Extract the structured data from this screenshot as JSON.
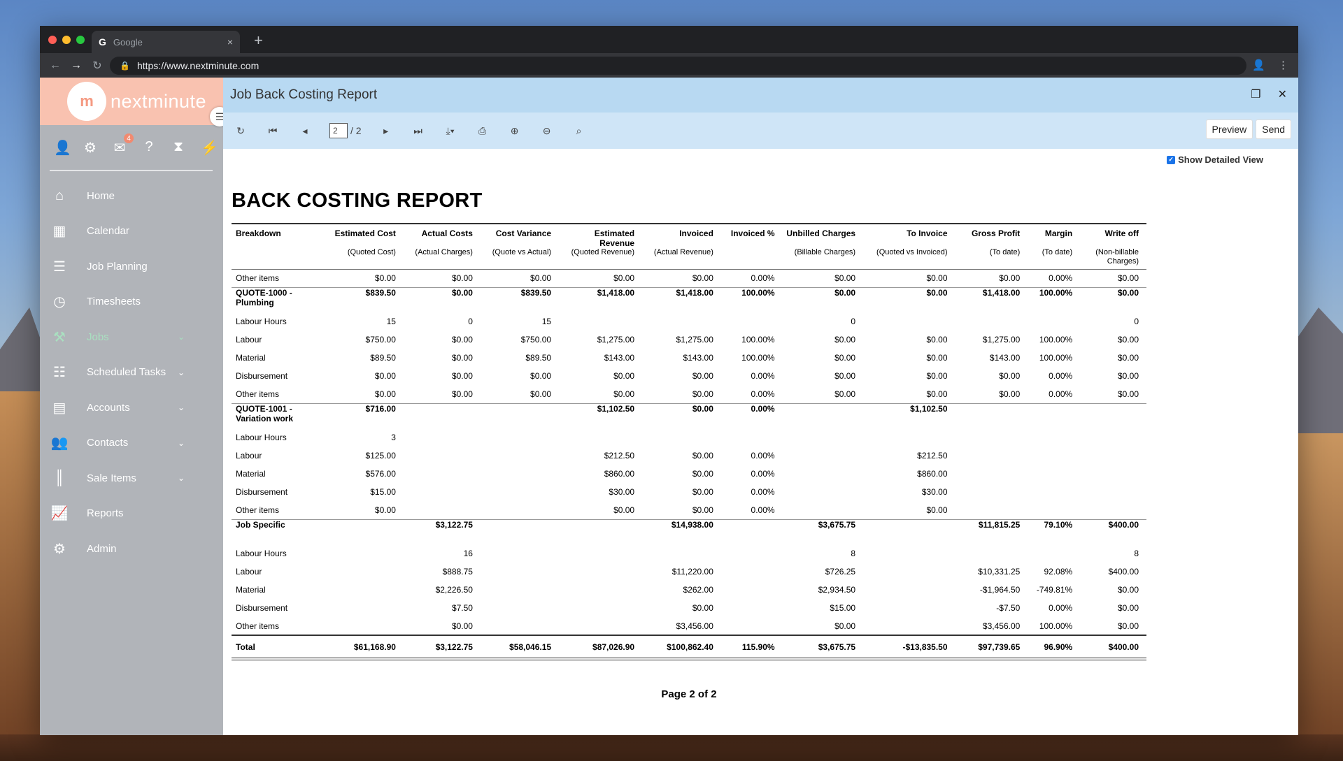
{
  "browser": {
    "tab_title": "Google",
    "tab_favicon": "G",
    "url": "https://www.nextminute.com"
  },
  "brand": {
    "logo_mark": "m",
    "logo_text": "nextminute",
    "color": "#f9c2b0"
  },
  "quick_icons": [
    {
      "name": "user-icon",
      "glyph": "👤"
    },
    {
      "name": "gear-icon",
      "glyph": "⚙"
    },
    {
      "name": "mail-icon",
      "glyph": "✉",
      "badge": "4"
    },
    {
      "name": "help-icon",
      "glyph": "?"
    },
    {
      "name": "hourglass-icon",
      "glyph": "⧗"
    },
    {
      "name": "bolt-icon",
      "glyph": "⚡"
    }
  ],
  "sidebar": {
    "items": [
      {
        "label": "Home",
        "icon": "home-icon",
        "glyph": "⌂"
      },
      {
        "label": "Calendar",
        "icon": "calendar-icon",
        "glyph": "▦"
      },
      {
        "label": "Job Planning",
        "icon": "list-icon",
        "glyph": "☰"
      },
      {
        "label": "Timesheets",
        "icon": "clock-icon",
        "glyph": "◷"
      },
      {
        "label": "Jobs",
        "icon": "hammer-icon",
        "glyph": "⚒",
        "chevron": true,
        "active": true
      },
      {
        "label": "Scheduled Tasks",
        "icon": "tasks-icon",
        "glyph": "☷",
        "chevron": true
      },
      {
        "label": "Accounts",
        "icon": "document-icon",
        "glyph": "▤",
        "chevron": true
      },
      {
        "label": "Contacts",
        "icon": "people-icon",
        "glyph": "👥",
        "chevron": true
      },
      {
        "label": "Sale Items",
        "icon": "barcode-icon",
        "glyph": "║",
        "chevron": true
      },
      {
        "label": "Reports",
        "icon": "chart-icon",
        "glyph": "📈"
      },
      {
        "label": "Admin",
        "icon": "admin-gear-icon",
        "glyph": "⚙"
      }
    ]
  },
  "report_window": {
    "title": "Job Back Costing Report",
    "page_current": "2",
    "page_total": "/ 2",
    "preview_label": "Preview",
    "send_label": "Send",
    "show_detailed_label": "Show Detailed View"
  },
  "report": {
    "title": "BACK COSTING REPORT",
    "columns": [
      {
        "head": "Breakdown",
        "sub": ""
      },
      {
        "head": "Estimated Cost",
        "sub": "(Quoted Cost)"
      },
      {
        "head": "Actual Costs",
        "sub": "(Actual Charges)"
      },
      {
        "head": "Cost Variance",
        "sub": "(Quote vs Actual)"
      },
      {
        "head": "Estimated Revenue",
        "sub": "(Quoted Revenue)"
      },
      {
        "head": "Invoiced",
        "sub": "(Actual Revenue)"
      },
      {
        "head": "Invoiced %",
        "sub": ""
      },
      {
        "head": "Unbilled Charges",
        "sub": "(Billable Charges)"
      },
      {
        "head": "To Invoice",
        "sub": "(Quoted vs Invoiced)"
      },
      {
        "head": "Gross Profit",
        "sub": "(To date)"
      },
      {
        "head": "Margin",
        "sub": "(To date)"
      },
      {
        "head": "Write off",
        "sub": "(Non-billable Charges)"
      }
    ],
    "rows": [
      {
        "type": "row",
        "cells": [
          "Other items",
          "$0.00",
          "$0.00",
          "$0.00",
          "$0.00",
          "$0.00",
          "0.00%",
          "$0.00",
          "$0.00",
          "$0.00",
          "0.00%",
          "$0.00"
        ]
      },
      {
        "type": "group",
        "cells": [
          "QUOTE-1000 - Plumbing",
          "$839.50",
          "$0.00",
          "$839.50",
          "$1,418.00",
          "$1,418.00",
          "100.00%",
          "$0.00",
          "$0.00",
          "$1,418.00",
          "100.00%",
          "$0.00"
        ]
      },
      {
        "type": "row",
        "cells": [
          "Labour Hours",
          "15",
          "0",
          "15",
          "",
          "",
          "",
          "0",
          "",
          "",
          "",
          "0"
        ]
      },
      {
        "type": "row",
        "cells": [
          "Labour",
          "$750.00",
          "$0.00",
          "$750.00",
          "$1,275.00",
          "$1,275.00",
          "100.00%",
          "$0.00",
          "$0.00",
          "$1,275.00",
          "100.00%",
          "$0.00"
        ]
      },
      {
        "type": "row",
        "cells": [
          "Material",
          "$89.50",
          "$0.00",
          "$89.50",
          "$143.00",
          "$143.00",
          "100.00%",
          "$0.00",
          "$0.00",
          "$143.00",
          "100.00%",
          "$0.00"
        ]
      },
      {
        "type": "row",
        "cells": [
          "Disbursement",
          "$0.00",
          "$0.00",
          "$0.00",
          "$0.00",
          "$0.00",
          "0.00%",
          "$0.00",
          "$0.00",
          "$0.00",
          "0.00%",
          "$0.00"
        ]
      },
      {
        "type": "row",
        "cells": [
          "Other items",
          "$0.00",
          "$0.00",
          "$0.00",
          "$0.00",
          "$0.00",
          "0.00%",
          "$0.00",
          "$0.00",
          "$0.00",
          "0.00%",
          "$0.00"
        ]
      },
      {
        "type": "group",
        "cells": [
          "QUOTE-1001 - Variation work",
          "$716.00",
          "",
          "",
          "$1,102.50",
          "$0.00",
          "0.00%",
          "",
          "$1,102.50",
          "",
          "",
          ""
        ]
      },
      {
        "type": "row",
        "cells": [
          "Labour Hours",
          "3",
          "",
          "",
          "",
          "",
          "",
          "",
          "",
          "",
          "",
          ""
        ]
      },
      {
        "type": "row",
        "cells": [
          "Labour",
          "$125.00",
          "",
          "",
          "$212.50",
          "$0.00",
          "0.00%",
          "",
          "$212.50",
          "",
          "",
          ""
        ]
      },
      {
        "type": "row",
        "cells": [
          "Material",
          "$576.00",
          "",
          "",
          "$860.00",
          "$0.00",
          "0.00%",
          "",
          "$860.00",
          "",
          "",
          ""
        ]
      },
      {
        "type": "row",
        "cells": [
          "Disbursement",
          "$15.00",
          "",
          "",
          "$30.00",
          "$0.00",
          "0.00%",
          "",
          "$30.00",
          "",
          "",
          ""
        ]
      },
      {
        "type": "row",
        "cells": [
          "Other items",
          "$0.00",
          "",
          "",
          "$0.00",
          "$0.00",
          "0.00%",
          "",
          "$0.00",
          "",
          "",
          ""
        ]
      },
      {
        "type": "group",
        "cells": [
          "Job Specific",
          "",
          "$3,122.75",
          "",
          "",
          "$14,938.00",
          "",
          "$3,675.75",
          "",
          "$11,815.25",
          "79.10%",
          "$400.00"
        ]
      },
      {
        "type": "row",
        "cells": [
          "Labour Hours",
          "",
          "16",
          "",
          "",
          "",
          "",
          "8",
          "",
          "",
          "",
          "8"
        ]
      },
      {
        "type": "row",
        "cells": [
          "Labour",
          "",
          "$888.75",
          "",
          "",
          "$11,220.00",
          "",
          "$726.25",
          "",
          "$10,331.25",
          "92.08%",
          "$400.00"
        ]
      },
      {
        "type": "row",
        "cells": [
          "Material",
          "",
          "$2,226.50",
          "",
          "",
          "$262.00",
          "",
          "$2,934.50",
          "",
          "-$1,964.50",
          "-749.81%",
          "$0.00"
        ]
      },
      {
        "type": "row",
        "cells": [
          "Disbursement",
          "",
          "$7.50",
          "",
          "",
          "$0.00",
          "",
          "$15.00",
          "",
          "-$7.50",
          "0.00%",
          "$0.00"
        ]
      },
      {
        "type": "row",
        "cells": [
          "Other items",
          "",
          "$0.00",
          "",
          "",
          "$3,456.00",
          "",
          "$0.00",
          "",
          "$3,456.00",
          "100.00%",
          "$0.00"
        ]
      },
      {
        "type": "total",
        "cells": [
          "Total",
          "$61,168.90",
          "$3,122.75",
          "$58,046.15",
          "$87,026.90",
          "$100,862.40",
          "115.90%",
          "$3,675.75",
          "-$13,835.50",
          "$97,739.65",
          "96.90%",
          "$400.00"
        ]
      }
    ],
    "footer": "Page 2 of 2"
  }
}
